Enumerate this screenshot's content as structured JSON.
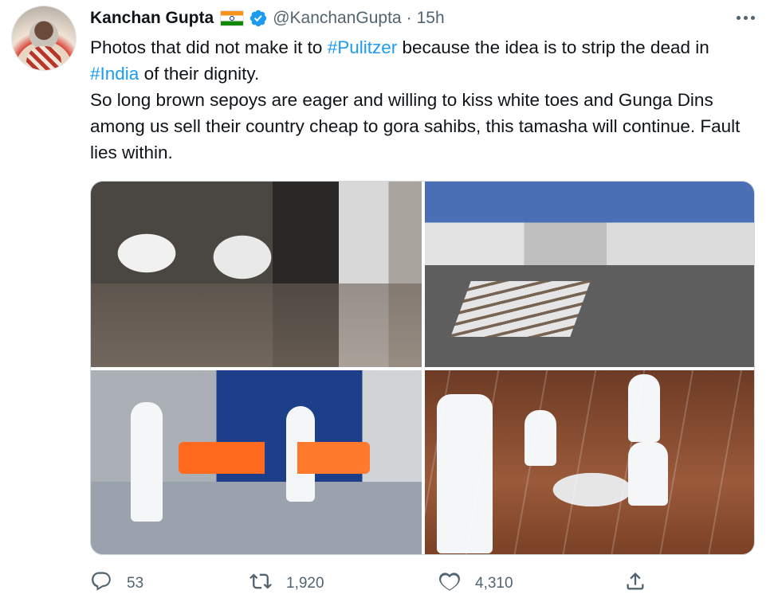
{
  "tweet": {
    "name": "Kanchan Gupta",
    "handle": "@KanchanGupta",
    "separator": "·",
    "time": "15h",
    "line1_a": "Photos that did not make it to ",
    "hashtag1": "#Pulitzer",
    "line1_b": " because the idea is to strip the dead in ",
    "hashtag2": "#India",
    "line1_c": " of their dignity.",
    "line2": "So long brown sepoys are eager and willing to kiss white toes and Gunga Dins among us sell their country cheap to gora sahibs, this tamasha will continue. Fault lies within."
  },
  "actions": {
    "replies": "53",
    "retweets": "1,920",
    "likes": "4,310"
  },
  "icons": {
    "flag": "india-flag-icon",
    "verified": "verified-badge-icon",
    "more": "more-options-icon",
    "reply": "reply-icon",
    "retweet": "retweet-icon",
    "like": "heart-icon",
    "share": "share-icon"
  },
  "colors": {
    "link": "#1d9bf0",
    "muted": "#536471",
    "text": "#0f1419"
  }
}
